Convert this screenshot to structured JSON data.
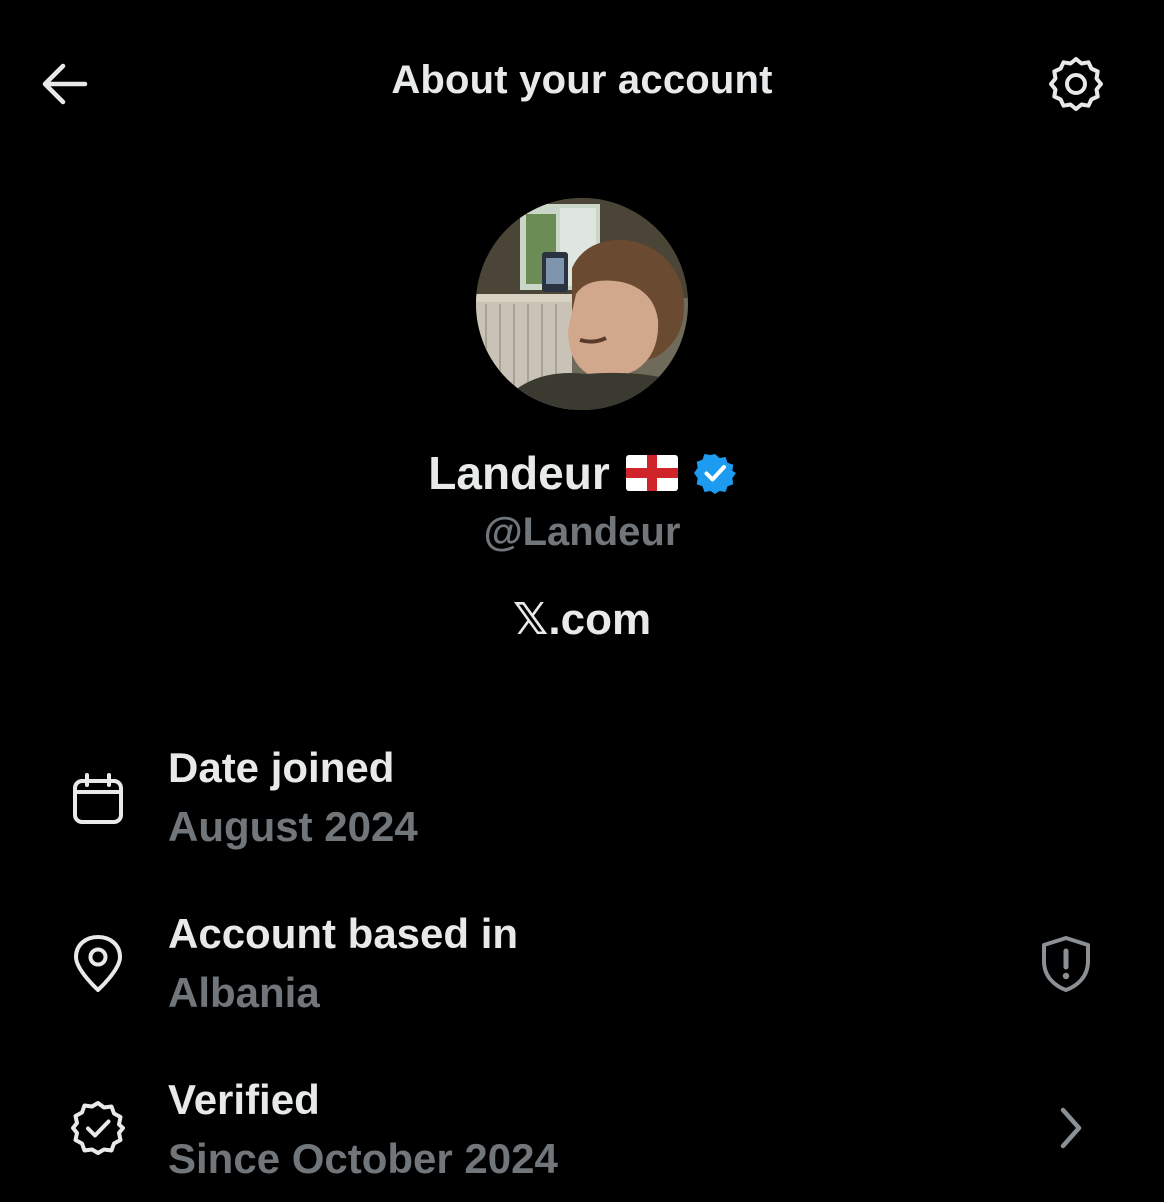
{
  "header": {
    "title": "About your account",
    "back_icon": "arrow-left-icon",
    "settings_icon": "gear-icon"
  },
  "profile": {
    "display_name": "Landeur",
    "flag": "England flag",
    "verified_badge_color": "#1d9bf0",
    "handle": "@Landeur",
    "site": ".com",
    "site_logo": "X"
  },
  "rows": [
    {
      "icon": "calendar-icon",
      "label": "Date joined",
      "value": "August 2024"
    },
    {
      "icon": "location-pin-icon",
      "label": "Account based in",
      "value": "Albania",
      "right_icon": "shield-alert-icon"
    },
    {
      "icon": "verified-badge-icon",
      "label": "Verified",
      "value": "Since October 2024",
      "right_icon": "chevron-right-icon"
    }
  ],
  "colors": {
    "background": "#000000",
    "primary_text": "#e7e9ea",
    "secondary_text": "#71767b",
    "accent": "#1d9bf0"
  }
}
